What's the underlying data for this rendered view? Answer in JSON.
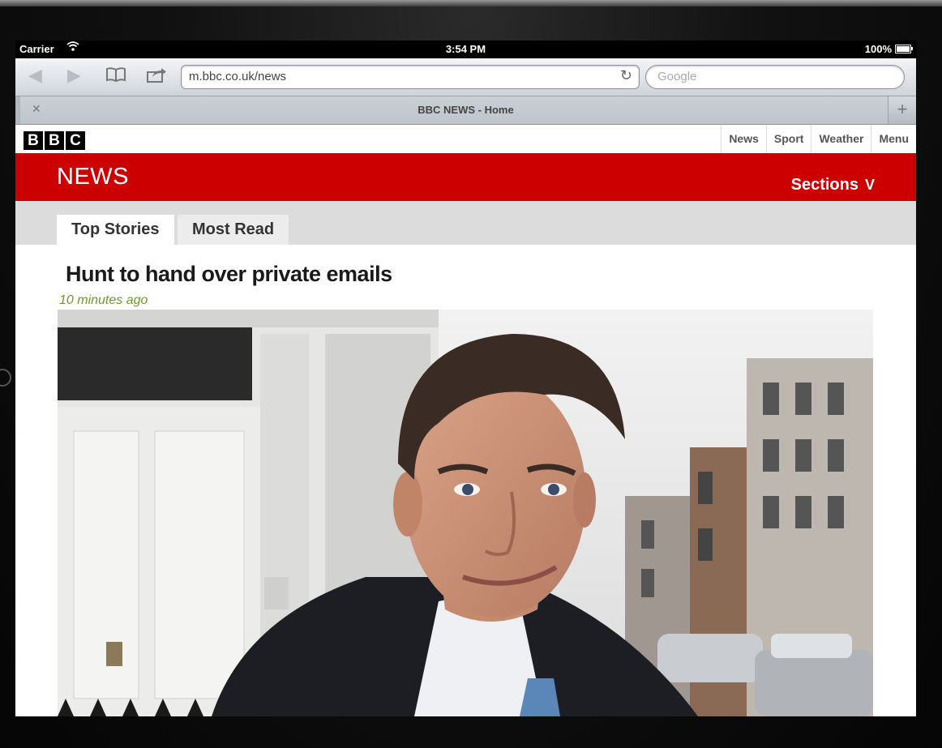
{
  "status_bar": {
    "carrier": "Carrier",
    "time": "3:54 PM",
    "battery": "100%"
  },
  "browser": {
    "url": "m.bbc.co.uk/news",
    "search_placeholder": "Google",
    "tab_title": "BBC NEWS - Home"
  },
  "site": {
    "logo_letters": [
      "B",
      "B",
      "C"
    ],
    "nav": [
      "News",
      "Sport",
      "Weather",
      "Menu"
    ],
    "section_title": "NEWS",
    "sections_label": "Sections",
    "tabs": [
      "Top Stories",
      "Most Read"
    ]
  },
  "article": {
    "headline": "Hunt to hand over private emails",
    "timestamp": "10 minutes ago"
  },
  "colors": {
    "bbc_red": "#cc0000",
    "timestamp_green": "#6b9b28"
  }
}
